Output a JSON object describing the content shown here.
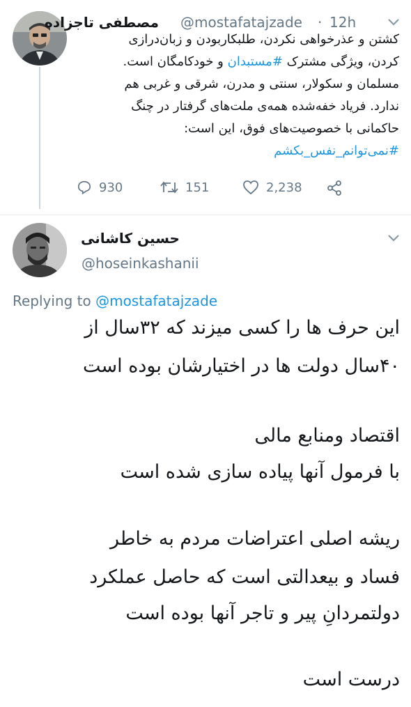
{
  "tweet1": {
    "author_name": "مصطفی تاجزاده",
    "handle": "@mostafatajzade",
    "separator": "·",
    "time": "12h",
    "lines": [
      "کشتن و عذرخواهی نکردن، طلبکاربودن و زبان‌درازی",
      "کردن، ویژگی مشترک #مستبدان و خودکامگان است.",
      "مسلمان و سکولار، سنتی و مدرن، شرقی و غربی هم",
      "ندارد. فریاد خفه‌شده همه‌ی ملت‌های گرفتار در چنگ",
      "حاکمانی با خصوصیت‌های فوق، این است:",
      "#نمی‌توانم_نفس_بکشم"
    ],
    "hashtag_inline": "#مستبدان",
    "actions": {
      "replies": "930",
      "retweets": "151",
      "likes": "2,238"
    }
  },
  "tweet2": {
    "author_name": "حسین کاشانی",
    "handle": "@hoseinkashanii",
    "replying_prefix": "Replying to",
    "replying_handle": "@mostafatajzade",
    "body_lines": [
      "این حرف ها را کسی میزند که ۳۲سال از",
      "۴۰سال دولت ها در اختیارشان بوده است",
      "",
      "اقتصاد ومنابع مالی",
      "با فرمول آنها پیاده سازی شده است",
      "",
      "ریشه اصلی اعتراضات مردم به خاطر",
      "فساد و بیعدالتی است که حاصل عملکرد",
      "دولتمردانِ پیر و تاجر آنها بوده است",
      "",
      "درست است"
    ]
  },
  "colors": {
    "link": "#1b95e0",
    "muted": "#657786",
    "text": "#14171a",
    "thread_line": "#ccd6dd"
  },
  "icons": [
    "reply-icon",
    "retweet-icon",
    "like-icon",
    "share-icon",
    "chevron-down-icon"
  ]
}
